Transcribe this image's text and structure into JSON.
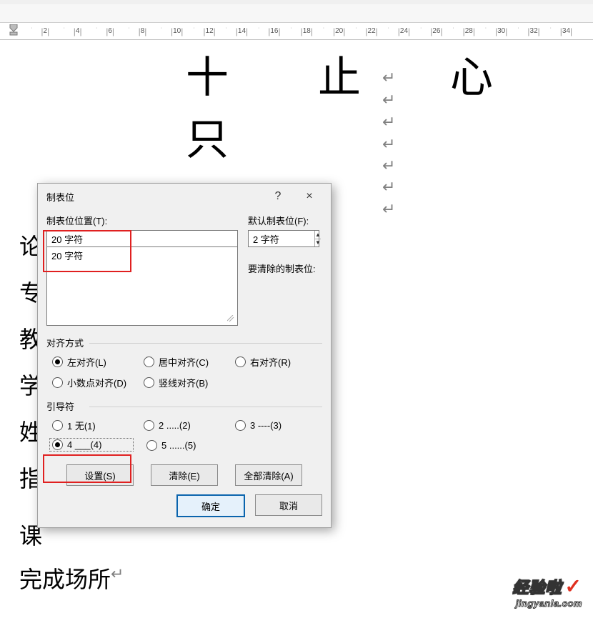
{
  "ruler": {
    "max": 34,
    "step": 2
  },
  "doc": {
    "big_line": "十 止 心 只",
    "side_chars": [
      "论",
      "专",
      "教",
      "学",
      "姓",
      "指",
      "课"
    ],
    "bottom_text": "完成场所",
    "cr_symbol": "↵"
  },
  "dialog": {
    "title": "制表位",
    "help": "?",
    "close": "×",
    "pos_label": "制表位位置(T):",
    "pos_label_u": "T",
    "pos_value": "20 字符",
    "pos_list_item": "20 字符",
    "default_label": "默认制表位(F):",
    "default_label_u": "F",
    "default_value": "2 字符",
    "clear_label": "要清除的制表位:",
    "align": {
      "title": "对齐方式",
      "left": "左对齐(L)",
      "center": "居中对齐(C)",
      "right": "右对齐(R)",
      "decimal": "小数点对齐(D)",
      "bar": "竖线对齐(B)",
      "selected": "left"
    },
    "leader": {
      "title": "引导符",
      "l1": "1 无(1)",
      "l2": "2 .....(2)",
      "l3": "3 ----(3)",
      "l4": "4 ___(4)",
      "l5": "5 ......(5)",
      "selected": "l4"
    },
    "buttons": {
      "set": "设置(S)",
      "clear": "清除(E)",
      "clear_all": "全部清除(A)",
      "ok": "确定",
      "cancel": "取消"
    }
  },
  "watermark": {
    "line1": "经验啦",
    "line2": "jingyanla.com"
  }
}
